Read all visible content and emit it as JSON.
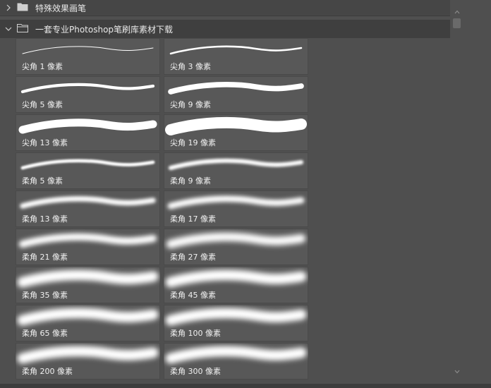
{
  "groups": {
    "closed": {
      "label": "特殊效果画笔",
      "icon": "folder-icon"
    },
    "open": {
      "label": "一套专业Photoshop笔刷库素材下载",
      "icon": "folder-open-icon"
    }
  },
  "brushes": [
    {
      "label": "尖角 1 像素",
      "kind": "hard",
      "size": 1
    },
    {
      "label": "尖角 3 像素",
      "kind": "hard",
      "size": 3
    },
    {
      "label": "尖角 5 像素",
      "kind": "hard",
      "size": 5
    },
    {
      "label": "尖角 9 像素",
      "kind": "hard",
      "size": 9
    },
    {
      "label": "尖角 13 像素",
      "kind": "hard",
      "size": 13
    },
    {
      "label": "尖角 19 像素",
      "kind": "hard",
      "size": 19
    },
    {
      "label": "柔角 5 像素",
      "kind": "soft",
      "size": 5
    },
    {
      "label": "柔角 9 像素",
      "kind": "soft",
      "size": 9
    },
    {
      "label": "柔角 13 像素",
      "kind": "soft",
      "size": 13
    },
    {
      "label": "柔角 17 像素",
      "kind": "soft",
      "size": 17
    },
    {
      "label": "柔角 21 像素",
      "kind": "soft",
      "size": 21
    },
    {
      "label": "柔角 27 像素",
      "kind": "soft",
      "size": 27
    },
    {
      "label": "柔角 35 像素",
      "kind": "soft",
      "size": 35
    },
    {
      "label": "柔角 45 像素",
      "kind": "soft",
      "size": 45
    },
    {
      "label": "柔角 65 像素",
      "kind": "soft",
      "size": 65
    },
    {
      "label": "柔角 100 像素",
      "kind": "soft",
      "size": 100
    },
    {
      "label": "柔角 200 像素",
      "kind": "soft",
      "size": 200
    },
    {
      "label": "柔角 300 像素",
      "kind": "soft",
      "size": 300
    }
  ]
}
